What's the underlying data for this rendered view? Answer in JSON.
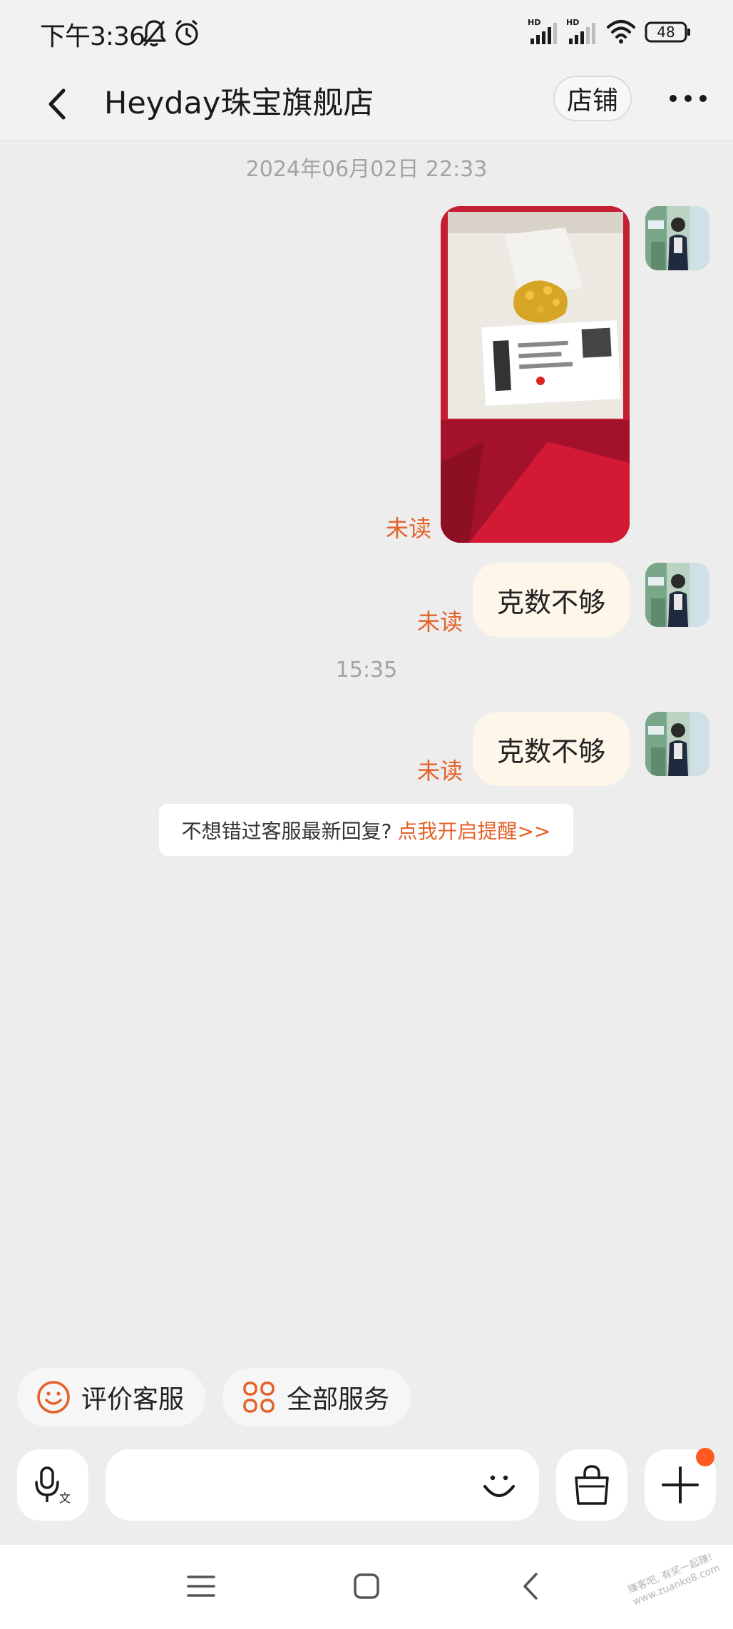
{
  "status_bar": {
    "time": "下午3:36",
    "battery": "48",
    "icons": [
      "bell-off-icon",
      "alarm-icon",
      "hd-signal-icon",
      "hd-signal-icon",
      "wifi-icon",
      "battery-icon"
    ]
  },
  "nav": {
    "title": "Heyday珠宝旗舰店",
    "shop_button": "店铺",
    "back_icon": "chevron-left-icon",
    "more_icon": "more-dots-icon"
  },
  "chat": {
    "timestamp_1": "2024年06月02日  22:33",
    "timestamp_2": "15:35",
    "messages": [
      {
        "type": "image",
        "image": "photo of gold chain in red jewelry box with price tag",
        "status": "未读"
      },
      {
        "type": "text",
        "text": "克数不够",
        "status": "未读"
      },
      {
        "type": "text",
        "text": "克数不够",
        "status": "未读"
      }
    ],
    "tip": {
      "text": "不想错过客服最新回复?",
      "link": "点我开启提醒>>"
    }
  },
  "quick_actions": [
    {
      "label": "评价客服",
      "icon": "smile-icon"
    },
    {
      "label": "全部服务",
      "icon": "grid-services-icon"
    }
  ],
  "input_bar": {
    "placeholder": "",
    "icons": [
      "voice-translate-icon",
      "emoji-icon",
      "shopping-bag-icon",
      "plus-icon"
    ]
  },
  "watermark": "赚客吧, 有奖一起赚!\nwww.zuanke8.com",
  "colors": {
    "accent": "#e4622a",
    "bubble": "#fdf6e9",
    "background": "#ededed",
    "badge": "#ff5a1f"
  }
}
